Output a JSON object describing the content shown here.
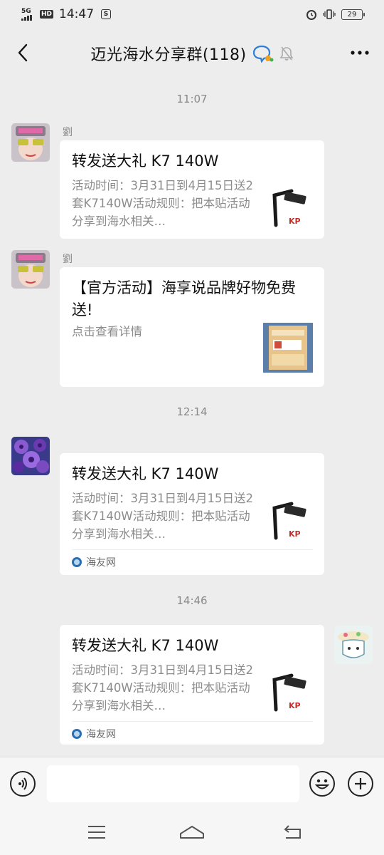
{
  "status_bar": {
    "network": "5G",
    "hd": "HD",
    "time": "14:47",
    "battery": "29"
  },
  "header": {
    "title": "迈光海水分享群(118)"
  },
  "messages": [
    {
      "timestamp": "11:07",
      "sender": "劉",
      "card": {
        "title": "转发送大礼 K7 140W",
        "desc": "活动时间：3月31日到4月15日送2套K7140W活动规则：把本贴活动分享到海水相关…",
        "thumb_icon": "lamp-product-image"
      }
    },
    {
      "sender": "劉",
      "card": {
        "title": "【官方活动】海享说品牌好物免费送!",
        "desc": "点击查看详情",
        "thumb_icon": "product-label-image"
      }
    },
    {
      "timestamp": "12:14",
      "card": {
        "title": "转发送大礼 K7 140W",
        "desc": "活动时间：3月31日到4月15日送2套K7140W活动规则：把本贴活动分享到海水相关…",
        "source": "海友网",
        "thumb_icon": "lamp-product-image"
      }
    },
    {
      "timestamp": "14:46",
      "card": {
        "title": "转发送大礼 K7 140W",
        "desc": "活动时间：3月31日到4月15日送2套K7140W活动规则：把本贴活动分享到海水相关…",
        "source": "海友网",
        "thumb_icon": "lamp-product-image"
      }
    }
  ],
  "input": {
    "value": "",
    "placeholder": ""
  }
}
